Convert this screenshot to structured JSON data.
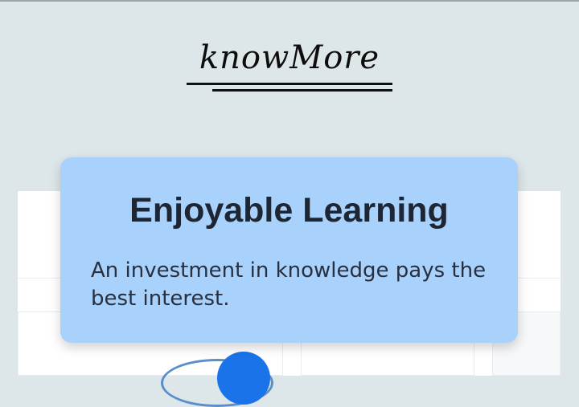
{
  "brand": {
    "logo_text": "knowMore"
  },
  "feature_card": {
    "title": "Enjoyable Learning",
    "description": "An investment in knowledge pays the best interest."
  },
  "colors": {
    "page_background": "#dde6e9",
    "card_background": "#a8d1fc",
    "title_text": "#1e2634",
    "accent_blue": "#1a73e8"
  }
}
